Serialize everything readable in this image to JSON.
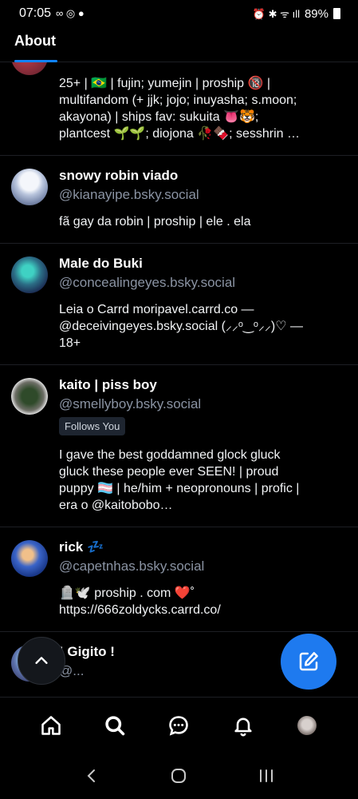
{
  "status_bar": {
    "time": "07:05",
    "battery": "89%"
  },
  "header": {
    "tab_label": "About"
  },
  "feed": [
    {
      "partial_handle": "@...",
      "bio": "25+ | 🇧🇷 | fujin; yumejin | proship 🔞 |\nmultifandom (+ jjk; jojo; inuyasha; s.moon;\nakayona) | ships fav: sukuita 👅🐯;\nplantcest 🌱🌱; diojona 🥀🍫; sesshrin …"
    },
    {
      "name": "snowy robin viado",
      "handle": "@kianayipe.bsky.social",
      "bio": "fã gay da robin | proship | ele . ela"
    },
    {
      "name": "Male do Buki",
      "handle": "@concealingeyes.bsky.social",
      "bio": "Leia o Carrd moripavel.carrd.co —\n@deceivingeyes.bsky.social (⸝⸝ᵒ‿ᵒ⸝⸝)♡ —\n18+"
    },
    {
      "name": "kaito | piss boy",
      "handle": "@smellyboy.bsky.social",
      "badge": "Follows You",
      "bio": "I gave the best goddamned glock gluck\ngluck these people ever SEEN! | proud\npuppy 🏳️‍⚧️ | he/him + neopronouns | profic |\nera o @kaitobobo…"
    },
    {
      "name": "rick 💤",
      "handle": "@capetnhas.bsky.social",
      "bio": "    🪦🕊️   proship . com    ❤️˚\nhttps://666zoldycks.carrd.co/"
    },
    {
      "name": "! Gigito !",
      "handle": "@..."
    }
  ],
  "icons": {
    "scroll_top": "chevron-up-icon",
    "compose": "compose-icon",
    "nav": [
      "home-icon",
      "search-icon",
      "chat-icon",
      "bell-icon",
      "profile-avatar"
    ],
    "system": [
      "back-icon",
      "home-circle-icon",
      "recents-icon"
    ]
  },
  "colors": {
    "accent": "#1083fe",
    "fab": "#1e7aef",
    "handle": "#8a93a3",
    "background": "#000000"
  }
}
